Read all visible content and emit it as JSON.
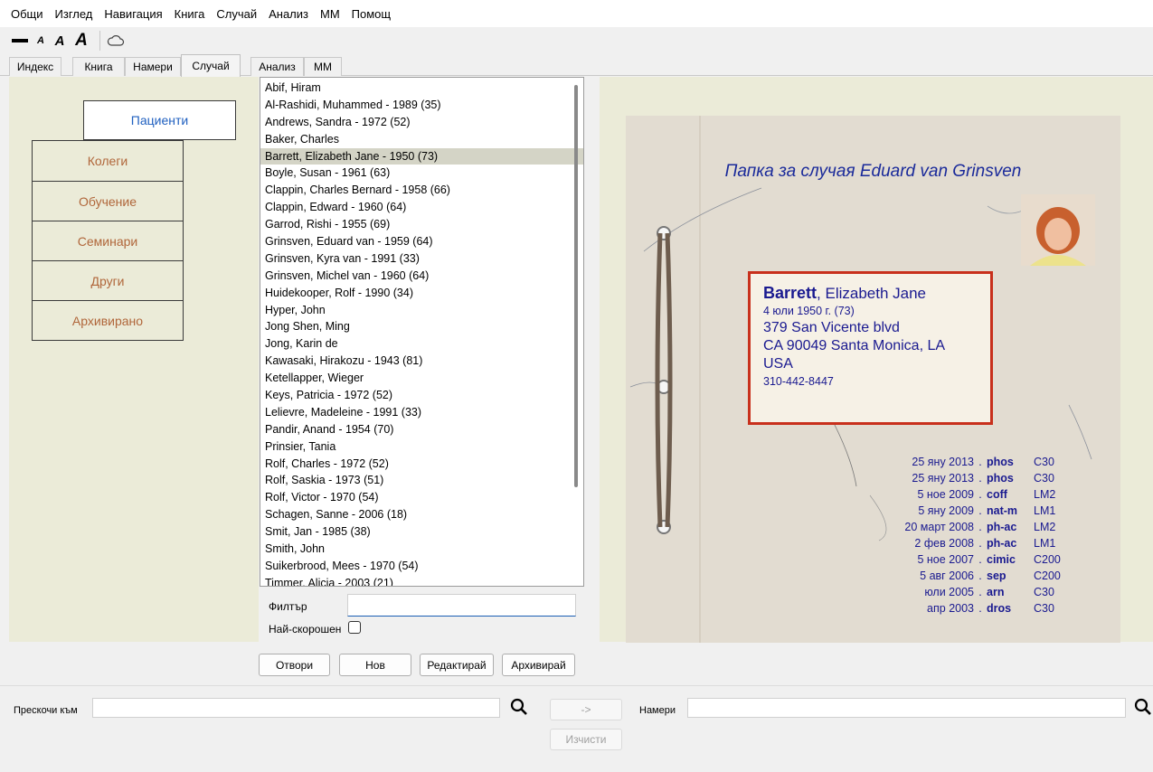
{
  "menu": [
    "Общи",
    "Изглед",
    "Навигация",
    "Книга",
    "Случай",
    "Анализ",
    "ММ",
    "Помощ"
  ],
  "tabs": [
    "Индекс",
    "Книга",
    "Намери",
    "Случай",
    "Анализ",
    "ММ"
  ],
  "active_tab": "Случай",
  "categories": [
    "Пациенти",
    "Колеги",
    "Обучение",
    "Семинари",
    "Други",
    "Архивирано"
  ],
  "patients": [
    "Abif, Hiram",
    "Al-Rashidi, Muhammed - 1989 (35)",
    "Andrews, Sandra - 1972 (52)",
    "Baker, Charles",
    "Barrett, Elizabeth Jane - 1950 (73)",
    "Boyle, Susan - 1961 (63)",
    "Clappin, Charles Bernard - 1958 (66)",
    "Clappin, Edward - 1960 (64)",
    "Garrod, Rishi - 1955 (69)",
    "Grinsven, Eduard van - 1959 (64)",
    "Grinsven, Kyra van - 1991 (33)",
    "Grinsven, Michel van - 1960 (64)",
    "Huidekooper, Rolf - 1990 (34)",
    "Hyper, John",
    "Jong Shen, Ming",
    "Jong, Karin de",
    "Kawasaki, Hirakozu - 1943 (81)",
    "Ketellapper, Wieger",
    "Keys, Patricia - 1972 (52)",
    "Lelievre, Madeleine - 1991 (33)",
    "Pandir, Anand - 1954 (70)",
    "Prinsier, Tania",
    "Rolf, Charles - 1972 (52)",
    "Rolf, Saskia - 1973 (51)",
    "Rolf, Victor - 1970 (54)",
    "Schagen, Sanne - 2006 (18)",
    "Smit, Jan - 1985 (38)",
    "Smith, John",
    "Suikerbrood, Mees - 1970 (54)",
    "Timmer, Alicia - 2003 (21)"
  ],
  "selected_patient": "Barrett, Elizabeth Jane - 1950 (73)",
  "filter": {
    "label": "Филтър",
    "value": ""
  },
  "recent": {
    "label": "Най-скорошен",
    "checked": false
  },
  "buttons": {
    "open": "Отвори",
    "new": "Нов",
    "edit": "Редактирай",
    "archive": "Архивирай"
  },
  "folder": {
    "title": "Папка за случая Eduard van Grinsven",
    "card": {
      "surname": "Barrett",
      "given": ", Elizabeth Jane",
      "dob": "4 юли 1950 г. (73)",
      "address1": "379 San Vicente blvd",
      "address2": "CA 90049  Santa Monica, LA",
      "country": "USA",
      "phone": "310-442-8447"
    },
    "remedies": [
      {
        "date": "25 яну 2013",
        "name": "phos",
        "potency": "C30"
      },
      {
        "date": "25 яну 2013",
        "name": "phos",
        "potency": "C30"
      },
      {
        "date": "5 ное 2009",
        "name": "coff",
        "potency": "LM2"
      },
      {
        "date": "5 яну 2009",
        "name": "nat-m",
        "potency": "LM1"
      },
      {
        "date": "20 март 2008",
        "name": "ph-ac",
        "potency": "LM2"
      },
      {
        "date": "2 фев 2008",
        "name": "ph-ac",
        "potency": "LM1"
      },
      {
        "date": "5 ное 2007",
        "name": "cimic",
        "potency": "C200"
      },
      {
        "date": "5 авг 2006",
        "name": "sep",
        "potency": "C200"
      },
      {
        "date": "юли 2005",
        "name": "arn",
        "potency": "C30"
      },
      {
        "date": "апр 2003",
        "name": "dros",
        "potency": "C30"
      }
    ]
  },
  "bottom": {
    "jump_label": "Прескочи към",
    "jump_value": "",
    "go_label": "->",
    "find_label": "Намери",
    "find_value": "",
    "clear_label": "Изчисти"
  }
}
